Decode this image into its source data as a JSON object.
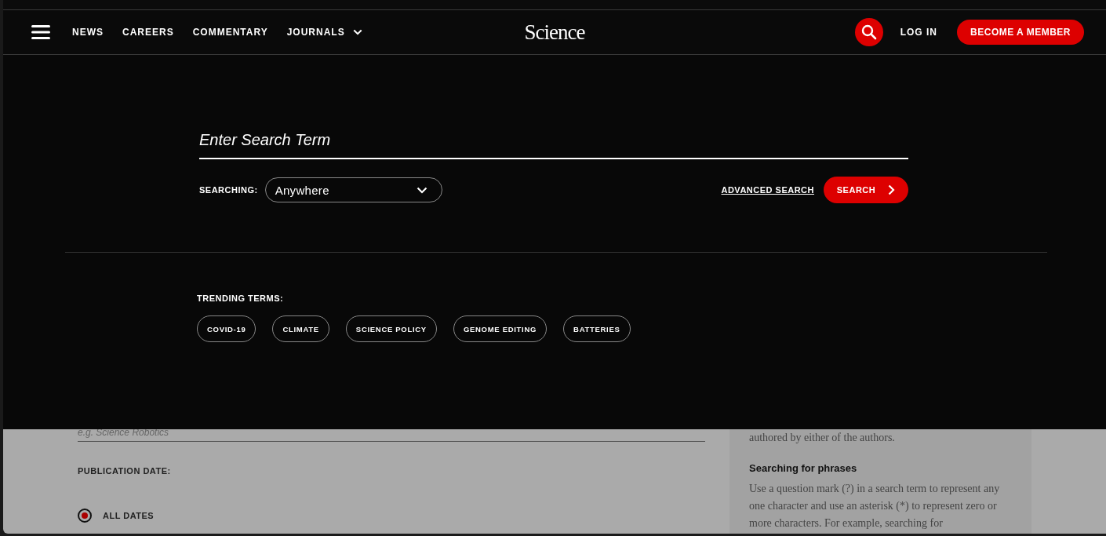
{
  "header": {
    "nav": [
      {
        "label": "NEWS",
        "has_dropdown": false
      },
      {
        "label": "CAREERS",
        "has_dropdown": false
      },
      {
        "label": "COMMENTARY",
        "has_dropdown": false
      },
      {
        "label": "JOURNALS",
        "has_dropdown": true
      }
    ],
    "logo": "Science",
    "login": "LOG IN",
    "member_button": "BECOME A MEMBER"
  },
  "search_panel": {
    "placeholder": "Enter Search Term",
    "searching_label": "SEARCHING:",
    "scope": "Anywhere",
    "advanced_link": "ADVANCED SEARCH",
    "search_button": "SEARCH",
    "trending_label": "TRENDING TERMS:",
    "trending_terms": [
      "COVID-19",
      "CLIMATE",
      "SCIENCE POLICY",
      "GENOME EDITING",
      "BATTERIES"
    ]
  },
  "page": {
    "journal_field_placeholder": "e.g. Science Robotics",
    "publication_date_label": "PUBLICATION DATE:",
    "date_options": [
      {
        "label": "ALL DATES",
        "selected": true
      }
    ],
    "help": {
      "text_fragment": "authored by either of the authors.",
      "heading": "Searching for phrases",
      "paragraph": "Use a question mark (?) in a search term to represent any one character and use an asterisk (*) to represent zero or more characters. For example, searching for"
    }
  }
}
